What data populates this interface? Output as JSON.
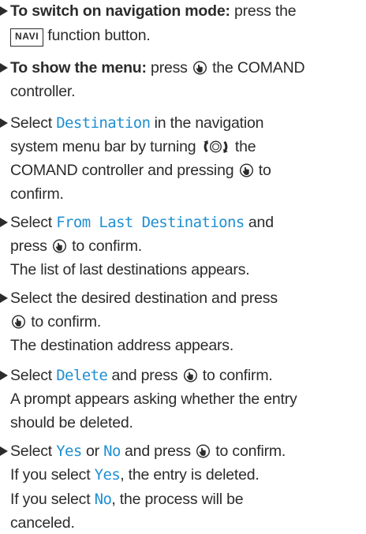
{
  "steps": [
    {
      "bold": "To switch on navigation mode:",
      "t1": " press the",
      "key": "NAVI",
      "t2": " function button."
    },
    {
      "bold": "To show the menu:",
      "t1": " press",
      "t2": " the COMAND",
      "t3": "controller."
    },
    {
      "t1": "Select ",
      "menu": "Destination",
      "t2": " in the navigation",
      "t3": "system menu bar by turning",
      "t4": " the",
      "t5": "COMAND controller and pressing",
      "t6": " to",
      "t7": "confirm."
    },
    {
      "t1": "Select ",
      "menu": "From Last Destinations",
      "t2": " and",
      "t3": "press",
      "t4": " to confirm.",
      "result": "The list of last destinations appears."
    },
    {
      "t1": "Select the desired destination and press",
      "t2": " to confirm.",
      "result": "The destination address appears."
    },
    {
      "t1": "Select ",
      "menu": "Delete",
      "t2": " and press",
      "t3": " to confirm.",
      "result1": "A prompt appears asking whether the entry",
      "result2": "should be deleted."
    },
    {
      "t1": "Select ",
      "yes": "Yes",
      "t2": " or ",
      "no": "No",
      "t3": " and press",
      "t4": " to confirm.",
      "r1a": "If you select ",
      "r1b": "Yes",
      "r1c": ", the entry is deleted.",
      "r2a": "If you select ",
      "r2b": "No",
      "r2c": ", the process will be",
      "r3": "canceled."
    }
  ],
  "icons": {
    "press": "controller-press-icon",
    "turn": "controller-turn-icon"
  }
}
